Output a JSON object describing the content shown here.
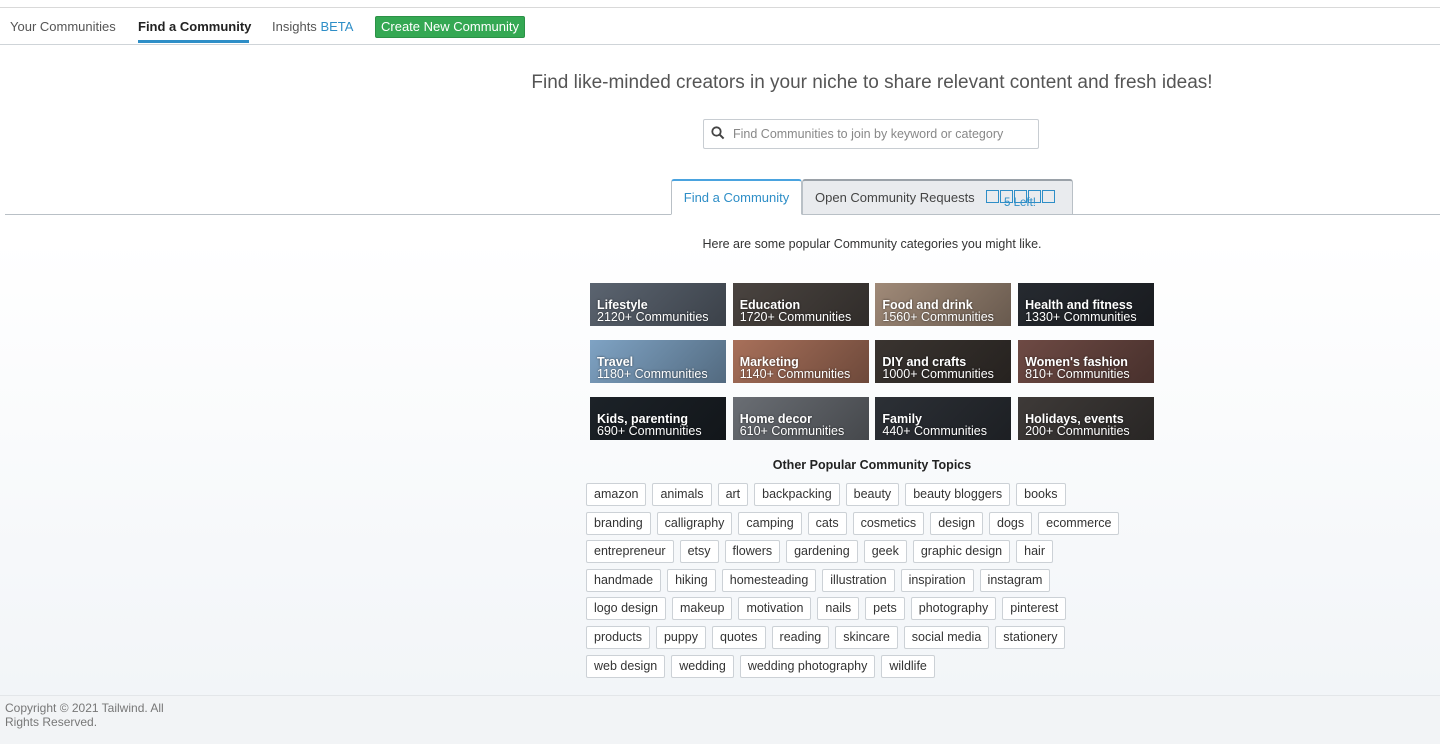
{
  "nav": {
    "your_communities": "Your Communities",
    "find_community": "Find a Community",
    "insights": "Insights",
    "insights_badge": "BETA",
    "create_button": "Create New Community"
  },
  "hero": {
    "headline": "Find like-minded creators in your niche to share relevant content and fresh ideas!",
    "search_placeholder": "Find Communities to join by keyword or category",
    "search_value": ""
  },
  "tabs": {
    "find": "Find a Community",
    "requests": "Open Community Requests",
    "requests_left": "5 Left!"
  },
  "categories_intro": "Here are some popular Community categories you might like.",
  "categories": [
    {
      "title": "Lifestyle",
      "count": "2120+ Communities"
    },
    {
      "title": "Education",
      "count": "1720+ Communities"
    },
    {
      "title": "Food and drink",
      "count": "1560+ Communities"
    },
    {
      "title": "Health and fitness",
      "count": "1330+ Communities"
    },
    {
      "title": "Travel",
      "count": "1180+ Communities"
    },
    {
      "title": "Marketing",
      "count": "1140+ Communities"
    },
    {
      "title": "DIY and crafts",
      "count": "1000+ Communities"
    },
    {
      "title": "Women's fashion",
      "count": "810+ Communities"
    },
    {
      "title": "Kids, parenting",
      "count": "690+ Communities"
    },
    {
      "title": "Home decor",
      "count": "610+ Communities"
    },
    {
      "title": "Family",
      "count": "440+ Communities"
    },
    {
      "title": "Holidays, events",
      "count": "200+ Communities"
    }
  ],
  "topics_title": "Other Popular Community Topics",
  "topics": [
    [
      "amazon",
      "animals",
      "art",
      "backpacking",
      "beauty",
      "beauty bloggers",
      "books"
    ],
    [
      "branding",
      "calligraphy",
      "camping",
      "cats",
      "cosmetics",
      "design",
      "dogs",
      "ecommerce"
    ],
    [
      "entrepreneur",
      "etsy",
      "flowers",
      "gardening",
      "geek",
      "graphic design",
      "hair"
    ],
    [
      "handmade",
      "hiking",
      "homesteading",
      "illustration",
      "inspiration",
      "instagram"
    ],
    [
      "logo design",
      "makeup",
      "motivation",
      "nails",
      "pets",
      "photography",
      "pinterest"
    ],
    [
      "products",
      "puppy",
      "quotes",
      "reading",
      "skincare",
      "social media",
      "stationery"
    ],
    [
      "web design",
      "wedding",
      "wedding photography",
      "wildlife"
    ]
  ],
  "footer": {
    "copyright": "Copyright © 2021 Tailwind. All Rights Reserved."
  },
  "colors": {
    "accent": "#2e8ec7",
    "create_button": "#34a853",
    "card_bg": [
      "#5b6470",
      "#4a4440",
      "#a08a78",
      "#262a30",
      "#7fa3c4",
      "#a8705a",
      "#3a3430",
      "#6e4a44",
      "#1c2228",
      "#6a6e74",
      "#2c3036",
      "#3e3a38"
    ]
  }
}
